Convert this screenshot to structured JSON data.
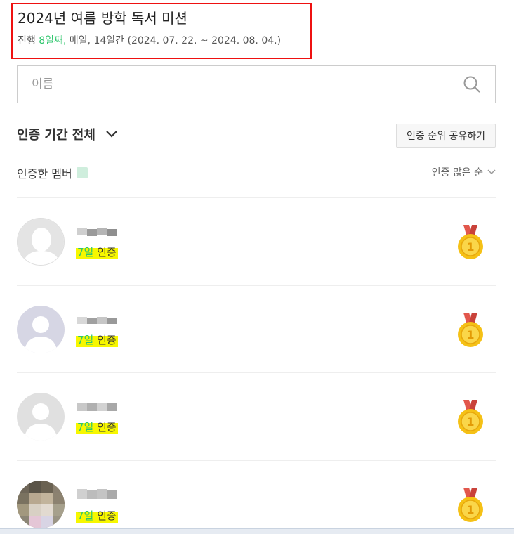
{
  "mission": {
    "title": "2024년 여름 방학 독서 미션",
    "status_prefix": "진행 ",
    "day_count": "8일째,",
    "schedule": " 매일, 14일간 (2024. 07. 22. ~ 2024. 08. 04.)"
  },
  "search": {
    "placeholder": "이름",
    "icon": "search-icon"
  },
  "filter": {
    "period_label": "인증 기간 전체",
    "share_button": "인증 순위 공유하기"
  },
  "members": {
    "label": "인증한 멤버",
    "sort_label": "인증 많은 순"
  },
  "ranking": [
    {
      "avatar": "default-avatar",
      "cert_days": "7일",
      "cert_suffix": " 인증",
      "rank": "1"
    },
    {
      "avatar": "default-avatar-lavender",
      "cert_days": "7일",
      "cert_suffix": " 인증",
      "rank": "1"
    },
    {
      "avatar": "default-avatar-gray",
      "cert_days": "7일",
      "cert_suffix": " 인증",
      "rank": "1"
    },
    {
      "avatar": "photo-avatar",
      "cert_days": "7일",
      "cert_suffix": " 인증",
      "rank": "1"
    }
  ],
  "colors": {
    "accent_green": "#2ec66c",
    "highlight_yellow": "#f7f700",
    "annotation_red": "#e11",
    "medal_gold": "#f5c116",
    "ribbon_red": "#e2574c"
  }
}
